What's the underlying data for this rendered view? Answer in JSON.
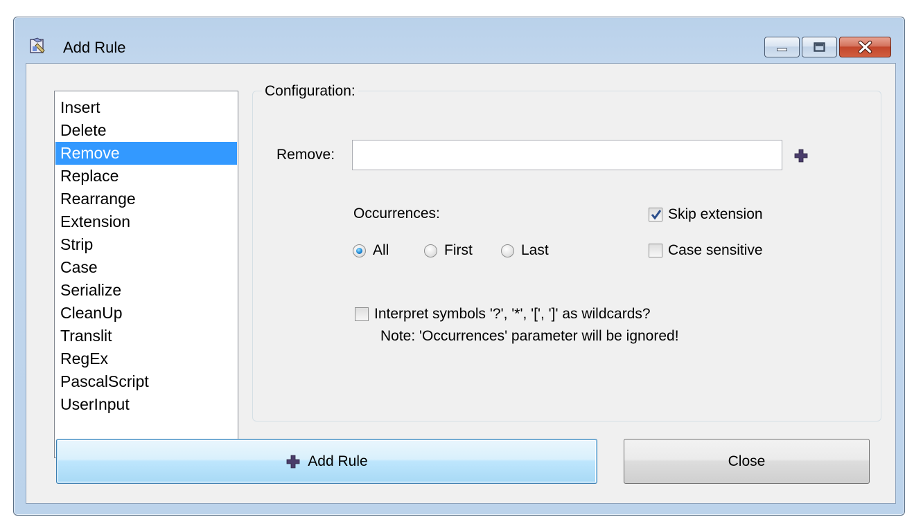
{
  "window": {
    "title": "Add Rule"
  },
  "rules": {
    "items": [
      "Insert",
      "Delete",
      "Remove",
      "Replace",
      "Rearrange",
      "Extension",
      "Strip",
      "Case",
      "Serialize",
      "CleanUp",
      "Translit",
      "RegEx",
      "PascalScript",
      "UserInput"
    ],
    "selected": "Remove"
  },
  "config": {
    "group_label": "Configuration:",
    "remove_label": "Remove:",
    "remove_value": "",
    "occurrences_label": "Occurrences:",
    "radio_all": "All",
    "radio_first": "First",
    "radio_last": "Last",
    "selected_occurrence": "All",
    "skip_extension": "Skip extension",
    "skip_extension_checked": true,
    "case_sensitive": "Case sensitive",
    "case_sensitive_checked": false,
    "wildcards": "Interpret symbols '?', '*', '[', ']' as wildcards?",
    "wildcards_checked": false,
    "wildcards_note": "Note: 'Occurrences' parameter will be ignored!"
  },
  "buttons": {
    "add_rule": "Add Rule",
    "close": "Close"
  },
  "colors": {
    "selection": "#3399ff",
    "plus_icon": "#4a3d6b",
    "close_button": "#c2462b"
  },
  "icons": {
    "title": "rule-app-icon",
    "add": "plus-icon"
  }
}
